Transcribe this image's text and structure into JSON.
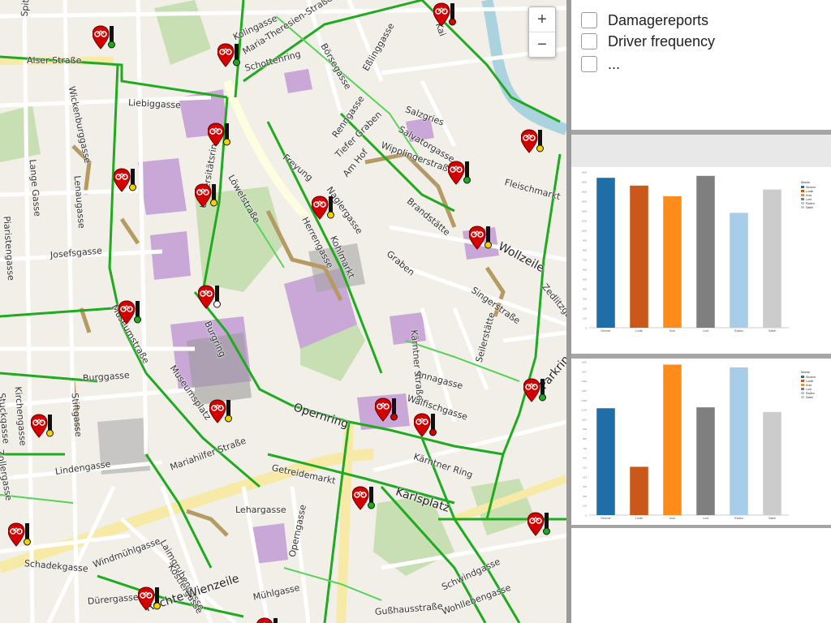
{
  "map": {
    "zoom_in": "+",
    "zoom_out": "−",
    "streets": [
      {
        "text": "Spitalgasse"
      },
      {
        "text": "Alser Straße"
      },
      {
        "text": "Wickenburggasse"
      },
      {
        "text": "Liebiggasse"
      },
      {
        "text": "Lange Gasse"
      },
      {
        "text": "Lenaugasse"
      },
      {
        "text": "Piaristengasse"
      },
      {
        "text": "Josefsgasse"
      },
      {
        "text": "Museumstraße"
      },
      {
        "text": "Burggasse"
      },
      {
        "text": "Kirchengasse"
      },
      {
        "text": "Stiftgasse"
      },
      {
        "text": "Stuckgasse"
      },
      {
        "text": "Zollergasse"
      },
      {
        "text": "Lindengasse"
      },
      {
        "text": "Mariahilfer Straße"
      },
      {
        "text": "Museumsplatz"
      },
      {
        "text": "Burgring"
      },
      {
        "text": "Universitätsring"
      },
      {
        "text": "Löwelstraße"
      },
      {
        "text": "Schottenring"
      },
      {
        "text": "Maria-Theresien-Straße"
      },
      {
        "text": "Kolingasse"
      },
      {
        "text": "Börsegasse"
      },
      {
        "text": "Eßlinggasse"
      },
      {
        "text": "Renngasse"
      },
      {
        "text": "Freyung"
      },
      {
        "text": "Tiefer Graben"
      },
      {
        "text": "Am Hof"
      },
      {
        "text": "Salzgries"
      },
      {
        "text": "Salvatorgasse"
      },
      {
        "text": "Wipplingerstraße"
      },
      {
        "text": "Naglergasse"
      },
      {
        "text": "Herrengasse"
      },
      {
        "text": "Kohlmarkt"
      },
      {
        "text": "Graben"
      },
      {
        "text": "Brandstätte"
      },
      {
        "text": "Fleischmarkt"
      },
      {
        "text": "Wollzeile"
      },
      {
        "text": "Singerstraße"
      },
      {
        "text": "Seilerstätte"
      },
      {
        "text": "Zedlitzgasse"
      },
      {
        "text": "Parkring"
      },
      {
        "text": "Kärntner Straße"
      },
      {
        "text": "Annagasse"
      },
      {
        "text": "Walfischgasse"
      },
      {
        "text": "Kärntner Ring"
      },
      {
        "text": "Opernring"
      },
      {
        "text": "Getreidemarkt"
      },
      {
        "text": "Karlsplatz"
      },
      {
        "text": "Lehargasse"
      },
      {
        "text": "Laimgrubengasse"
      },
      {
        "text": "Köstlergasse"
      },
      {
        "text": "Windmühlgasse"
      },
      {
        "text": "Schadekgasse"
      },
      {
        "text": "Rechte Wienzeile"
      },
      {
        "text": "Mühlgasse"
      },
      {
        "text": "Operngasse"
      },
      {
        "text": "Gußhausstraße"
      },
      {
        "text": "Schwindgasse"
      },
      {
        "text": "Wohllebengasse"
      },
      {
        "text": "Dürergasse"
      },
      {
        "text": "Kai"
      },
      {
        "text": "Fleischmarkt"
      }
    ]
  },
  "panel": {
    "options": [
      {
        "label": "Damagereports",
        "checked": false
      },
      {
        "label": "Driver frequency",
        "checked": false
      },
      {
        "label": "...",
        "checked": false
      }
    ]
  },
  "colors": {
    "marker_red": "#d40000",
    "bike_lane": "#1faa1f",
    "bar_blue": "#1f6ea8",
    "bar_darkorange": "#c9581a",
    "bar_orange": "#ff8c1a",
    "bar_gray": "#7f7f7f",
    "bar_lightblue": "#a8cdeb",
    "bar_lightgray": "#cccccc"
  },
  "chart_data": [
    {
      "type": "bar",
      "categories": [
        "Stromer",
        "Luxtik",
        "Kraz",
        "Lord",
        "Radius",
        "Sattel"
      ],
      "values": [
        1540,
        1460,
        1350,
        1560,
        1180,
        1420
      ],
      "ylim": [
        0,
        1600
      ],
      "colors": [
        "#1f6ea8",
        "#c9581a",
        "#ff8c1a",
        "#7f7f7f",
        "#a8cdeb",
        "#cccccc"
      ],
      "legend_title": "Marke",
      "legend_position": "right"
    },
    {
      "type": "bar",
      "categories": [
        "Stromer",
        "Luxtik",
        "Kraz",
        "Lord",
        "Radius",
        "Sattel"
      ],
      "values": [
        1150,
        520,
        1620,
        1160,
        1590,
        1110
      ],
      "ylim": [
        0,
        1650
      ],
      "colors": [
        "#1f6ea8",
        "#c9581a",
        "#ff8c1a",
        "#7f7f7f",
        "#a8cdeb",
        "#cccccc"
      ],
      "legend_title": "Marke",
      "legend_position": "right"
    }
  ]
}
